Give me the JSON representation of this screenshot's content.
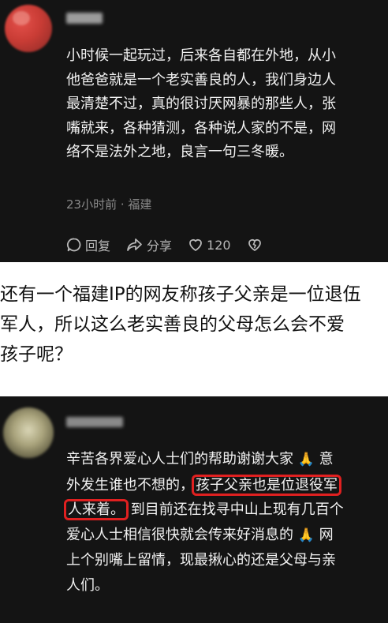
{
  "comment1": {
    "lines": [
      "小时候一起玩过，后来各自都在外地，从小",
      "他爸爸就是一个老实善良的人，我们身边人",
      "最清楚不过，真的很讨厌网暴的那些人，张",
      "嘴就来，各种猜测，各种说人家的不是，网",
      "络不是法外之地，良言一句三冬暖。"
    ],
    "meta": "23小时前 · 福建",
    "reply_label": "回复",
    "share_label": "分享",
    "like_count": "120"
  },
  "caption": {
    "lines": [
      "还有一个福建IP的网友称孩子父亲是一位退伍",
      "军人，所以这么老实善良的父母怎么会不爱",
      "孩子呢？"
    ]
  },
  "comment2": {
    "l1a": "辛苦各界爱心人士们的帮助谢谢大家",
    "l1b": "意",
    "l2a": "外发生谁也不想的，",
    "l2hl": "孩子父亲也是位退役军",
    "l3hl": "人来着。",
    "l3b": "到目前还在找寻中山上现有几百个",
    "l4a": "爱心人士相信很快就会传来好消息的",
    "l4b": "网",
    "l5": "上个别嘴上留情，现最揪心的还是父母与亲",
    "l6": "人们。",
    "emoji_icon": "praying-hands-icon"
  }
}
